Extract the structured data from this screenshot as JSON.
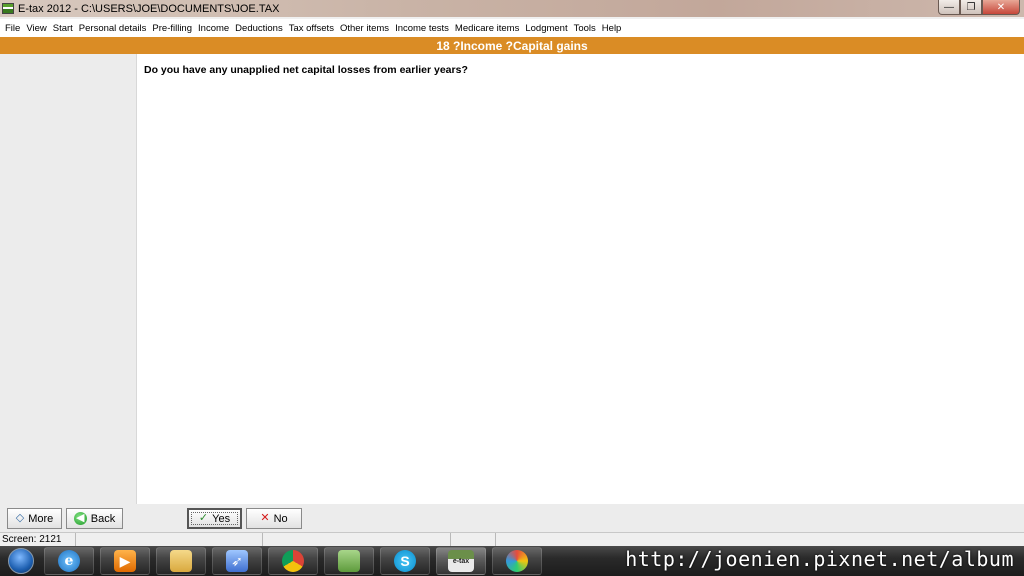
{
  "window": {
    "title": "E-tax 2012 - C:\\USERS\\JOE\\DOCUMENTS\\JOE.TAX",
    "controls": {
      "minimize": "—",
      "maximize": "❐",
      "close": "✕"
    }
  },
  "menu": {
    "items": [
      "File",
      "View",
      "Start",
      "Personal details",
      "Pre-filling",
      "Income",
      "Deductions",
      "Tax offsets",
      "Other items",
      "Income tests",
      "Medicare items",
      "Lodgment",
      "Tools",
      "Help"
    ]
  },
  "header": {
    "title": "18 ?Income ?Capital gains"
  },
  "content": {
    "question": "Do you have any unapplied net capital losses from earlier years?"
  },
  "buttons": {
    "more": {
      "label": "More",
      "icon": "diamond-icon"
    },
    "back": {
      "label": "Back",
      "icon": "back-arrow-icon"
    },
    "yes": {
      "label": "Yes",
      "icon": "checkmark-icon"
    },
    "no": {
      "label": "No",
      "icon": "cross-icon"
    }
  },
  "status": {
    "screen": "Screen: 2121"
  },
  "taskbar": {
    "apps": [
      "internet-explorer",
      "media-player",
      "file-explorer",
      "rocket-launcher",
      "chrome",
      "file-manager",
      "skype",
      "e-tax",
      "paint"
    ],
    "etax_label": "e-tax"
  },
  "watermark": "http://joenien.pixnet.net/album",
  "colors": {
    "header_bg": "#da8c25",
    "titlebar": "#c9b3a6",
    "close_button": "#c6473a"
  }
}
